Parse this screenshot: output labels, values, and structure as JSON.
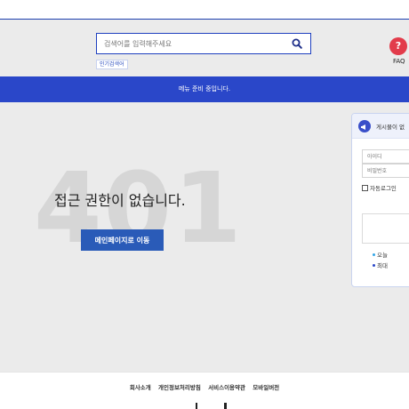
{
  "search": {
    "placeholder": "검색어를 입력해주세요",
    "popular_label": "인기검색어"
  },
  "faq": {
    "label": "FAQ",
    "icon_char": "?"
  },
  "notice": {
    "text": "메뉴 준비 중입니다."
  },
  "error": {
    "code": "401",
    "message": "접근 권한이 없습니다.",
    "button_label": "메인페이지로 이동"
  },
  "login_panel": {
    "title": "게시물이 없",
    "id_placeholder": "아이디",
    "password_placeholder": "비밀번호",
    "auto_login_label": "자동로그인",
    "stats": {
      "today_label": "오늘",
      "max_label": "최대"
    }
  },
  "footer": {
    "links": [
      "회사소개",
      "개인정보처리방침",
      "서비스이용약관",
      "모바일버전"
    ]
  },
  "colors": {
    "primary": "#2a47c9",
    "button": "#2a5bb8",
    "faq": "#e23b4a",
    "background": "#ebebeb"
  },
  "icons": [
    "search-icon",
    "question-icon",
    "megaphone-icon"
  ]
}
